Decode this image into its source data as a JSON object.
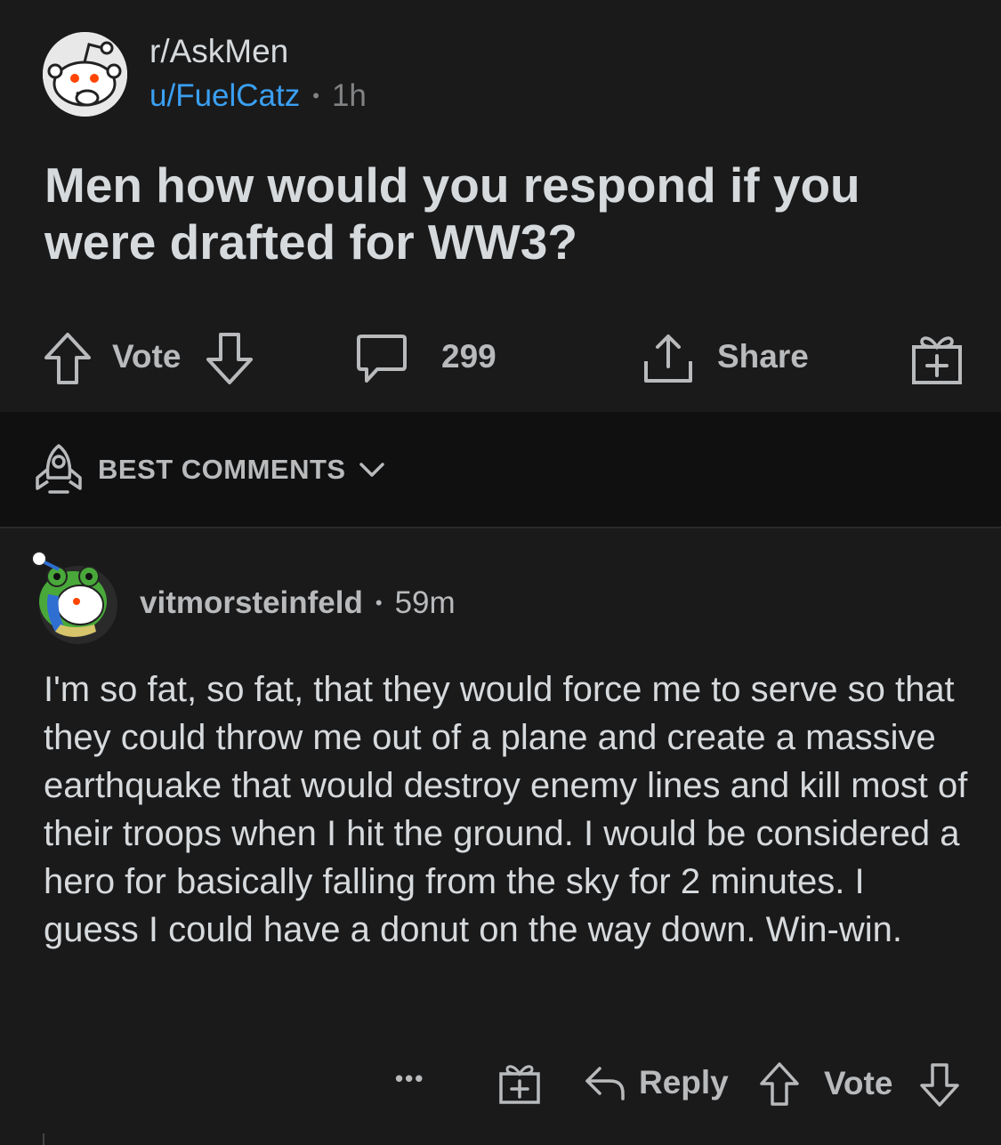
{
  "post": {
    "subreddit": "r/AskMen",
    "author": "u/FuelCatz",
    "separator": "•",
    "age": "1h",
    "title": "Men how would you respond if you were drafted for WW3?",
    "actions": {
      "vote_label": "Vote",
      "comment_count": "299",
      "share_label": "Share"
    }
  },
  "sort": {
    "label": "BEST COMMENTS"
  },
  "comment": {
    "author": "vitmorsteinfeld",
    "separator": "•",
    "age": "59m",
    "body": "I'm so fat, so fat, that they would force me to serve so that they could throw me out of a plane and create a massive earthquake that would destroy enemy lines and kill most of their troops when I hit the ground. I would be considered a hero for basically falling from the sky for 2 minutes. I guess I could have a donut on the way down. Win-win.",
    "actions": {
      "more_label": "•••",
      "reply_label": "Reply",
      "vote_label": "Vote"
    }
  },
  "icons": {
    "upvote": "arrow-up-icon",
    "downvote": "arrow-down-icon",
    "comment": "speech-bubble-icon",
    "share": "share-icon",
    "award": "gift-icon",
    "sort": "rocket-icon",
    "reply": "reply-arrow-icon"
  },
  "colors": {
    "background": "#1a1a1b",
    "sort_background": "#101011",
    "text_primary": "#d7dadc",
    "text_secondary": "#818384",
    "link_blue": "#3aa0f3",
    "snoo_red": "#ff4500"
  }
}
